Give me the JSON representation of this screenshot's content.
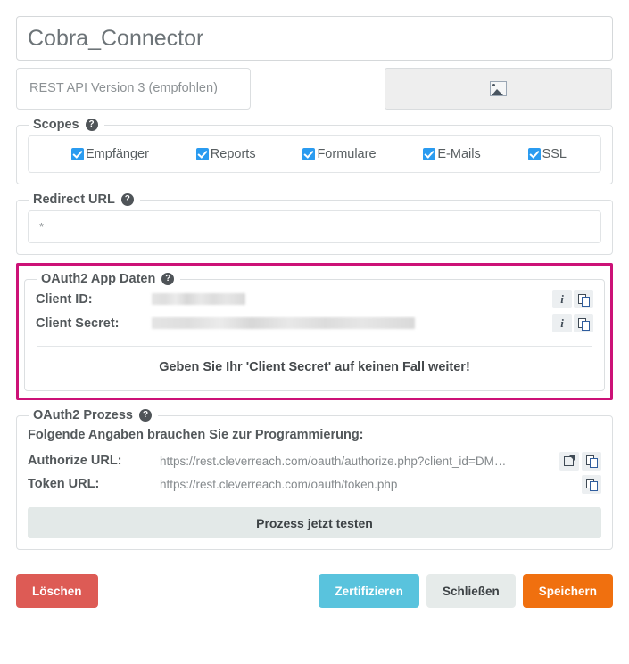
{
  "form": {
    "app_name": "Cobra_Connector",
    "api_version": "REST API Version 3 (empfohlen)",
    "image_placeholder_icon": "image-placeholder-icon"
  },
  "scopes": {
    "legend": "Scopes",
    "help_icon": "help-icon",
    "items": [
      {
        "label": "Empfänger",
        "checked": true
      },
      {
        "label": "Reports",
        "checked": true
      },
      {
        "label": "Formulare",
        "checked": true
      },
      {
        "label": "E-Mails",
        "checked": true
      },
      {
        "label": "SSL",
        "checked": true
      }
    ]
  },
  "redirect": {
    "legend": "Redirect URL",
    "help_icon": "help-icon",
    "value": "*"
  },
  "app_data": {
    "legend": "OAuth2 App Daten",
    "help_icon": "help-icon",
    "highlight_color": "#cc1177",
    "client_id_label": "Client ID:",
    "client_id_value": "",
    "client_secret_label": "Client Secret:",
    "client_secret_value": "",
    "info_icon": "info-icon",
    "copy_icon": "copy-icon",
    "warning": "Geben Sie Ihr 'Client Secret' auf keinen Fall weiter!"
  },
  "process": {
    "legend": "OAuth2 Prozess",
    "help_icon": "help-icon",
    "intro": "Folgende Angaben brauchen Sie zur Programmierung:",
    "authorize_label": "Authorize URL:",
    "authorize_value": "https://rest.cleverreach.com/oauth/authorize.php?client_id=DM…",
    "token_label": "Token URL:",
    "token_value": "https://rest.cleverreach.com/oauth/token.php",
    "external_icon": "external-link-icon",
    "copy_icon": "copy-icon",
    "test_button": "Prozess jetzt testen"
  },
  "footer": {
    "delete": "Löschen",
    "certify": "Zertifizieren",
    "close": "Schließen",
    "save": "Speichern",
    "colors": {
      "delete": "#dd5b55",
      "certify": "#59c3dd",
      "close": "#e6ebea",
      "save": "#f0700f"
    }
  }
}
